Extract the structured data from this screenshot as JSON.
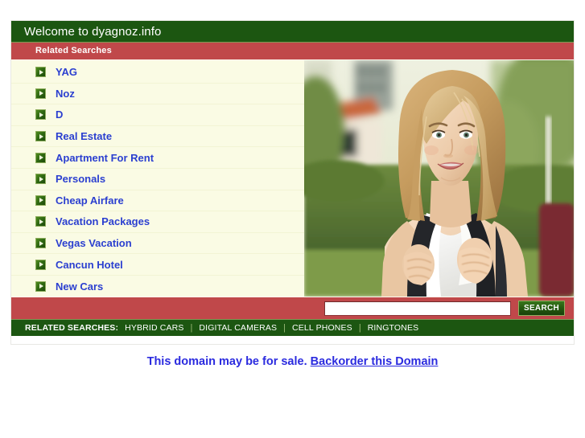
{
  "header": {
    "title": "Welcome to dyagnoz.info",
    "bar_color": "#1c5611"
  },
  "related_searches_bar": {
    "label": "Related Searches",
    "bar_color": "#c0484a"
  },
  "links": {
    "bullet_icon": "green-arrow-bullet-icon",
    "items": [
      {
        "label": "YAG"
      },
      {
        "label": "Noz"
      },
      {
        "label": "D"
      },
      {
        "label": "Real Estate"
      },
      {
        "label": "Apartment For Rent"
      },
      {
        "label": "Personals"
      },
      {
        "label": "Cheap Airfare"
      },
      {
        "label": "Vacation Packages"
      },
      {
        "label": "Vegas Vacation"
      },
      {
        "label": "Cancun Hotel"
      },
      {
        "label": "New Cars"
      }
    ],
    "link_color": "#2b3fd0",
    "background": "#fafbe4"
  },
  "photo": {
    "alt": "smiling blonde woman with backpack outdoors",
    "name": "hero-photo"
  },
  "search": {
    "value": "",
    "placeholder": "",
    "button_label": "SEARCH"
  },
  "bottom_related_searches": {
    "label": "RELATED SEARCHES:",
    "items": [
      {
        "label": "HYBRID CARS"
      },
      {
        "label": "DIGITAL CAMERAS"
      },
      {
        "label": "CELL PHONES"
      },
      {
        "label": "RINGTONES"
      }
    ],
    "separator": "|",
    "bar_color": "#1c5611"
  },
  "footer": {
    "sale_text": "This domain may be for sale.",
    "backorder_link": "Backorder this Domain",
    "text_color": "#2b2bdf"
  }
}
